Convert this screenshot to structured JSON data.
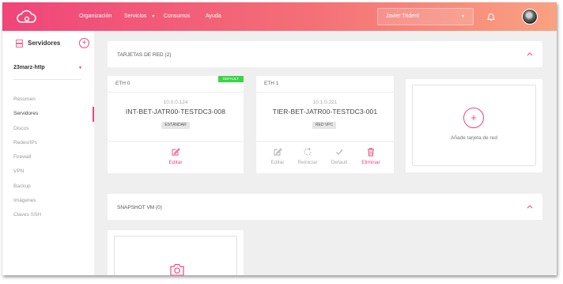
{
  "topbar": {
    "nav": [
      "Organización",
      "Servicios",
      "Consumos",
      "Ayuda"
    ],
    "user": "Javier Trident",
    "icons": [
      "cloud-logo",
      "bell-icon",
      "avatar"
    ],
    "colors": {
      "gradient_start": "#f0457a",
      "gradient_end": "#f9a281"
    }
  },
  "sidebar": {
    "title": "Servidores",
    "add": "+",
    "server": "23marz-http",
    "menu": [
      "Resumen",
      "Servidores",
      "Discos",
      "Redes/IPs",
      "Firewall",
      "VPN",
      "Backup",
      "Imágenes",
      "Claves SSH"
    ],
    "active": "Servidores"
  },
  "network": {
    "title": "TARJETAS DE RED (2)",
    "cards": [
      {
        "eth": "ETH 0",
        "badge": "DEFAULT",
        "ip": "10.0.0.124",
        "name": "INT-BET-JATR00-TESTDC3-008",
        "tag": "ESTÁNDAR",
        "actions": [
          {
            "label": "Editar"
          }
        ]
      },
      {
        "eth": "ETH 1",
        "ip": "10.1.0.221",
        "name": "TIER-BET-JATR00-TESTDC3-001",
        "tag": "RED VPC",
        "actions": [
          {
            "label": "Editar"
          },
          {
            "label": "Reiniciar"
          },
          {
            "label": "Default"
          },
          {
            "label": "Eliminar"
          }
        ]
      }
    ],
    "add_label": "Añade tarjeta de red",
    "add_symbol": "+"
  },
  "snapshot": {
    "title": "SNAPSHOT VM (0)"
  }
}
